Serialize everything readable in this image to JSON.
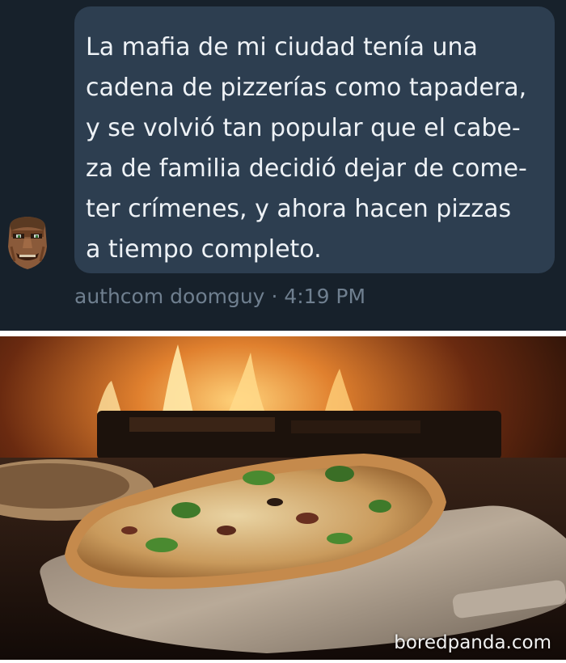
{
  "message": {
    "lines": [
      "La mafia de mi ciudad tenía una",
      "cadena de pizzerías como tapadera,",
      "y se volvió tan popular que el cabe-",
      "za de familia decidió dejar de come-",
      "ter crímenes, y ahora hacen pizzas",
      "a tiempo completo."
    ],
    "author": "authcom doomguy",
    "separator": "·",
    "time": "4:19 PM"
  },
  "avatar": {
    "icon": "doomguy-face-icon"
  },
  "photo": {
    "subject": "pizza-on-peel-photo"
  },
  "watermark": "boredpanda.com",
  "colors": {
    "chat_background": "#17212b",
    "bubble": "#2d3e50",
    "bubble_text": "#eef2f6",
    "meta_text": "#6f7f8f"
  }
}
